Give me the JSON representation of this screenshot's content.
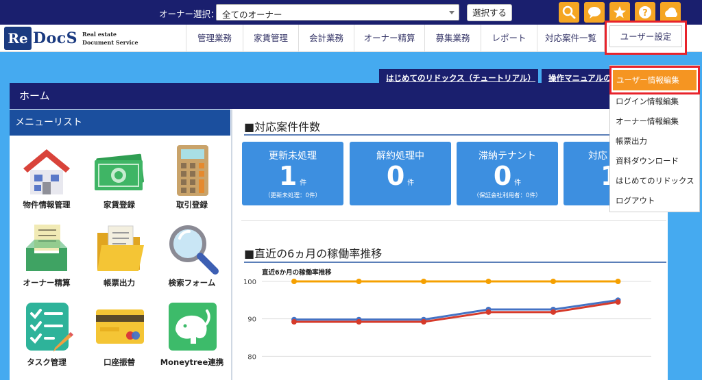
{
  "topbar": {
    "owner_label": "オーナー選択：",
    "owner_selected": "全てのオーナー",
    "select_button": "選択する",
    "icons": [
      "search-icon",
      "chat-icon",
      "star-icon",
      "help-icon",
      "cloud-icon"
    ],
    "icon_color": "#f5a623"
  },
  "logo": {
    "mark": "Re",
    "name": "DocS",
    "sub_line1": "Real estate",
    "sub_line2": "Document Service"
  },
  "nav": {
    "items": [
      "管理業務",
      "家賃管理",
      "会計業務",
      "オーナー精算",
      "募集業務",
      "レポート",
      "対応案件一覧"
    ],
    "user_settings": "ユーザー設定"
  },
  "tabs": {
    "tutorial": "はじめてのリドックス（チュートリアル）",
    "manual": "操作マニュアルの"
  },
  "home": {
    "title": "ホーム",
    "menu_title": "メニューリスト",
    "menu_items": [
      "物件情報管理",
      "家賃登録",
      "取引登録",
      "オーナー精算",
      "帳票出力",
      "検索フォーム",
      "タスク管理",
      "口座振替",
      "Moneytree連携"
    ]
  },
  "cases": {
    "title": "■対応案件件数",
    "cards": [
      {
        "title": "更新未処理",
        "count": "1",
        "unit": "件",
        "note": "（更新未処理：0件）"
      },
      {
        "title": "解約処理中",
        "count": "0",
        "unit": "件",
        "note": ""
      },
      {
        "title": "滞納テナント",
        "count": "0",
        "unit": "件",
        "note": "（保証会社利用者：0件）"
      },
      {
        "title": "対応",
        "count": "1",
        "unit": "",
        "note": ""
      }
    ]
  },
  "occupancy": {
    "title": "■直近の6ヵ月の稼働率推移"
  },
  "chart_data": {
    "type": "line",
    "title": "直近6か月の稼働率推移",
    "x": [
      1,
      2,
      3,
      4,
      5,
      6
    ],
    "ylim": [
      70,
      100
    ],
    "yticks": [
      100,
      90,
      80,
      70
    ],
    "grid": true,
    "series": [
      {
        "values": [
          100,
          100,
          100,
          100,
          100,
          100
        ],
        "color": "#f5a000"
      },
      {
        "values": [
          89.8,
          89.8,
          89.8,
          92.5,
          92.5,
          95
        ],
        "color": "#4472c4"
      },
      {
        "values": [
          89.2,
          89.2,
          89.2,
          91.8,
          91.8,
          94.5
        ],
        "color": "#d63a2a"
      }
    ]
  },
  "user_menu": {
    "items": [
      "ユーザー情報編集",
      "ログイン情報編集",
      "オーナー情報編集",
      "帳票出力",
      "資料ダウンロード",
      "はじめてのリドックス",
      "ログアウト"
    ],
    "active_color": "#f59522",
    "highlight_color": "#e8232b"
  }
}
